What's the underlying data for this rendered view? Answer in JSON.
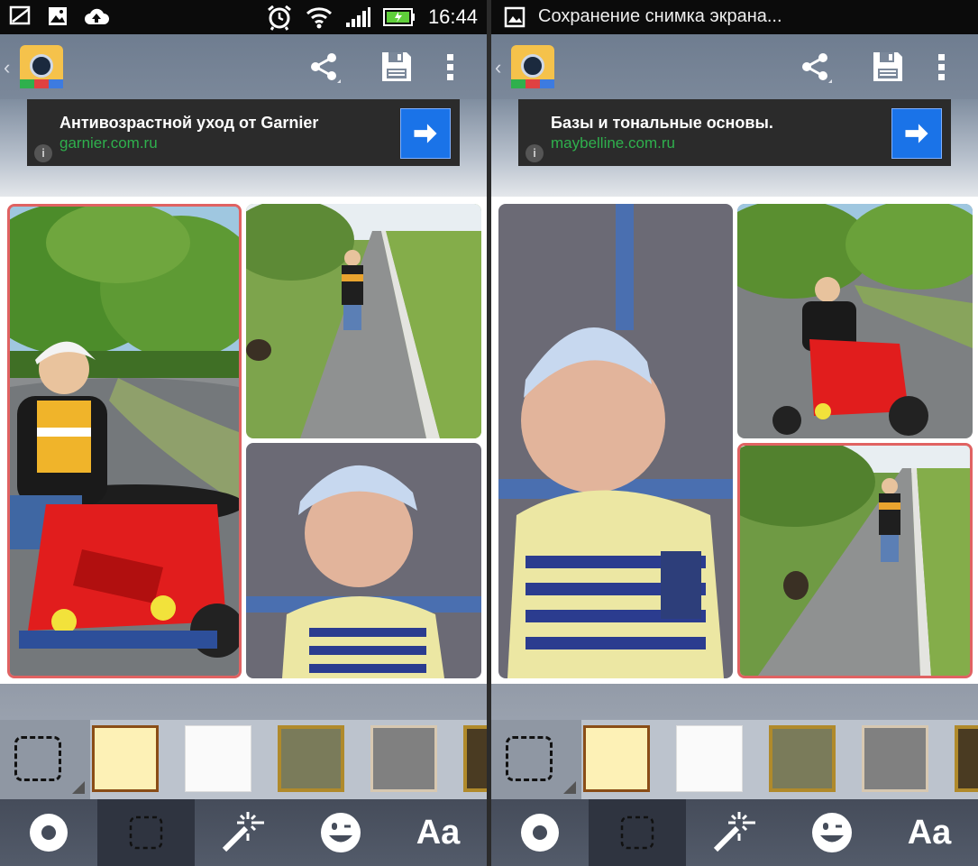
{
  "left": {
    "status": {
      "time": "16:44"
    },
    "ad": {
      "title": "Антивозрастной уход от Garnier",
      "url": "garnier.com.ru",
      "info": "i"
    },
    "text_button": "Aa"
  },
  "right": {
    "status": {
      "notification": "Сохранение снимка экрана..."
    },
    "ad": {
      "title": "Базы и тональные основы.",
      "url": "maybelline.com.ru",
      "info": "i"
    },
    "text_button": "Aa"
  },
  "icons": [
    "photo-screenshot-icon",
    "gallery-icon",
    "cloud-upload-icon",
    "alarm-icon",
    "wifi-icon",
    "signal-icon",
    "battery-icon",
    "share-icon",
    "save-icon",
    "overflow-icon",
    "back-chevron-icon",
    "shape-icon",
    "frame-icon",
    "magic-wand-icon",
    "sticker-icon"
  ],
  "colors": {
    "selection": "#e06262",
    "ad_button": "#1a73e8",
    "ad_url": "#2fb04d",
    "frames": [
      "#fdf1b6",
      "#fafafa",
      "#7a7b5a",
      "#808080",
      "#4a3b22"
    ]
  }
}
